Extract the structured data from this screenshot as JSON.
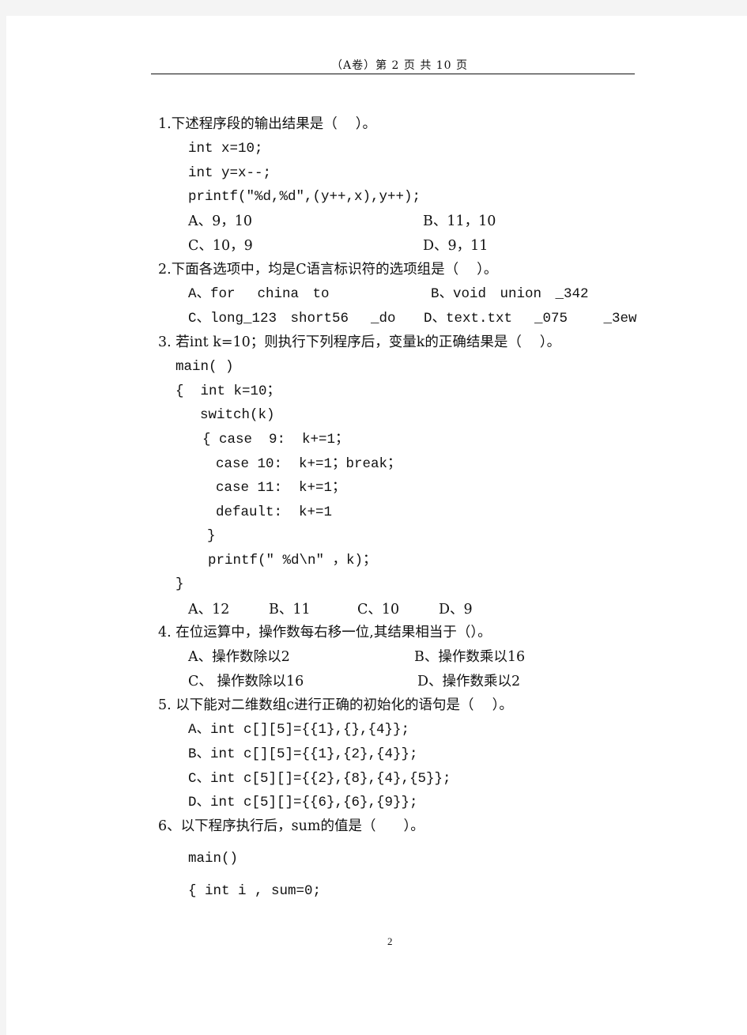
{
  "header": {
    "text": "（A卷）第 2 页 共 10 页"
  },
  "questions": [
    {
      "stem": "1.下述程序段的输出结果是（　 ）。",
      "code": [
        "int x=10;",
        "int y=x--;",
        "printf(\"%d,%d\",(y++,x),y++);"
      ],
      "options": [
        "A、9，10",
        "B、11，10",
        "C、10，9",
        "D、9，11"
      ]
    },
    {
      "stem": "2.下面各选项中，均是C语言标识符的选项组是（　 ）。",
      "options": [
        "A、for　 china　to",
        "B、void　union　_342",
        "C、long_123　short56　 _do",
        "D、text.txt　 _075　　 _3ew"
      ]
    },
    {
      "stem": "3. 若int k=10；则执行下列程序后，变量k的正确结果是（　 ）。",
      "code": [
        "main( )",
        "{  int k=10；",
        "switch(k)",
        "{ case  9:  k+=1；",
        "case 10:  k+=1；break；",
        "case 11:  k+=1；",
        "default:  k+=1",
        "}",
        "printf(\" %d\\n\" ，k)；",
        "}"
      ],
      "options": [
        "A、12",
        "B、11",
        "C、10",
        "D、9"
      ]
    },
    {
      "stem": "4. 在位运算中，操作数每右移一位,其结果相当于（）。",
      "options": [
        "A、操作数除以2",
        "B、操作数乘以16",
        "C、 操作数除以16",
        "D、操作数乘以2"
      ]
    },
    {
      "stem": "5. 以下能对二维数组c进行正确的初始化的语句是（　 ）。",
      "options": [
        "A、int c[][5]={{1},{},{4}};",
        "B、int c[][5]={{1},{2},{4}};",
        "C、int c[5][]={{2},{8},{4},{5}};",
        "D、int c[5][]={{6},{6},{9}};"
      ]
    },
    {
      "stem": "6、以下程序执行后，sum的值是（　　）。",
      "code": [
        "main()",
        "{ int i , sum=0;"
      ]
    }
  ],
  "footer": {
    "page_number": "2"
  }
}
